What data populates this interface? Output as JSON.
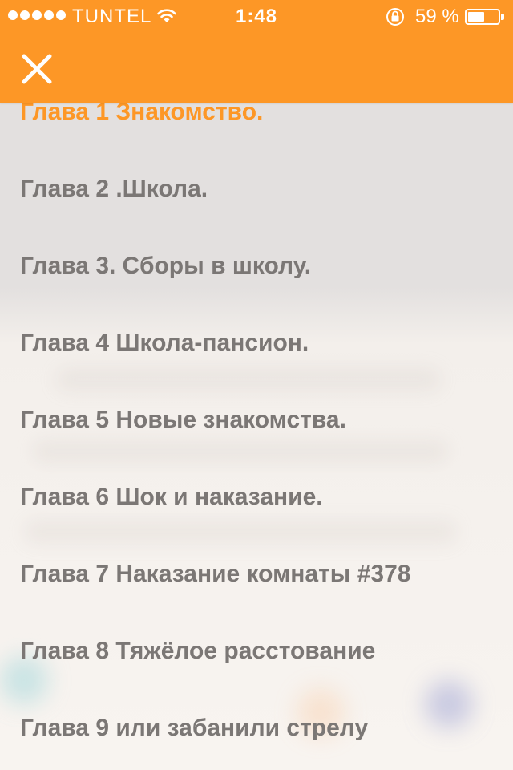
{
  "status_bar": {
    "carrier": "TUNTEL",
    "time": "1:48",
    "battery_percent_text": "59 %",
    "battery_level": 0.59
  },
  "header": {
    "close_icon": "close-icon"
  },
  "chapters": [
    {
      "label": "Глава 1 Знакомство.",
      "active": true
    },
    {
      "label": "Глава 2 .Школа.",
      "active": false
    },
    {
      "label": "Глава 3. Сборы в школу.",
      "active": false
    },
    {
      "label": "Глава 4 Школа-пансион.",
      "active": false
    },
    {
      "label": "Глава 5 Новые знакомства.",
      "active": false
    },
    {
      "label": "Глава 6 Шок и наказание.",
      "active": false
    },
    {
      "label": "Глава 7 Наказание комнаты #378",
      "active": false
    },
    {
      "label": "Глава 8 Тяжёлое расстование",
      "active": false
    },
    {
      "label": "Глава 9 или забанили стрелу",
      "active": false
    }
  ],
  "colors": {
    "accent": "#fd9726",
    "chapter_text": "#7b7775",
    "background": "#f6f3f0"
  }
}
